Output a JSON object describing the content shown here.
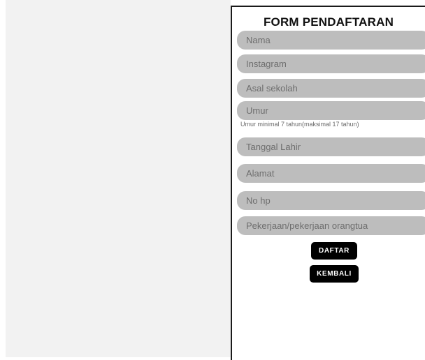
{
  "form": {
    "title": "FORM PENDAFTARAN",
    "fields": [
      {
        "placeholder": "Nama"
      },
      {
        "placeholder": "Instagram"
      },
      {
        "placeholder": "Asal sekolah"
      },
      {
        "placeholder": "Umur"
      },
      {
        "placeholder": "Tanggal Lahir"
      },
      {
        "placeholder": "Alamat"
      },
      {
        "placeholder": "No hp"
      },
      {
        "placeholder": "Pekerjaan/pekerjaan orangtua"
      }
    ],
    "age_hint": "Umur minimal 7 tahun(maksimal 17 tahun)",
    "submit_label": "DAFTAR",
    "back_label": "KEMBALI"
  },
  "colors": {
    "field_bg": "#bdbdbd",
    "button_bg": "#000000",
    "button_text": "#ffffff",
    "left_pane_bg": "#f2f2f2"
  }
}
